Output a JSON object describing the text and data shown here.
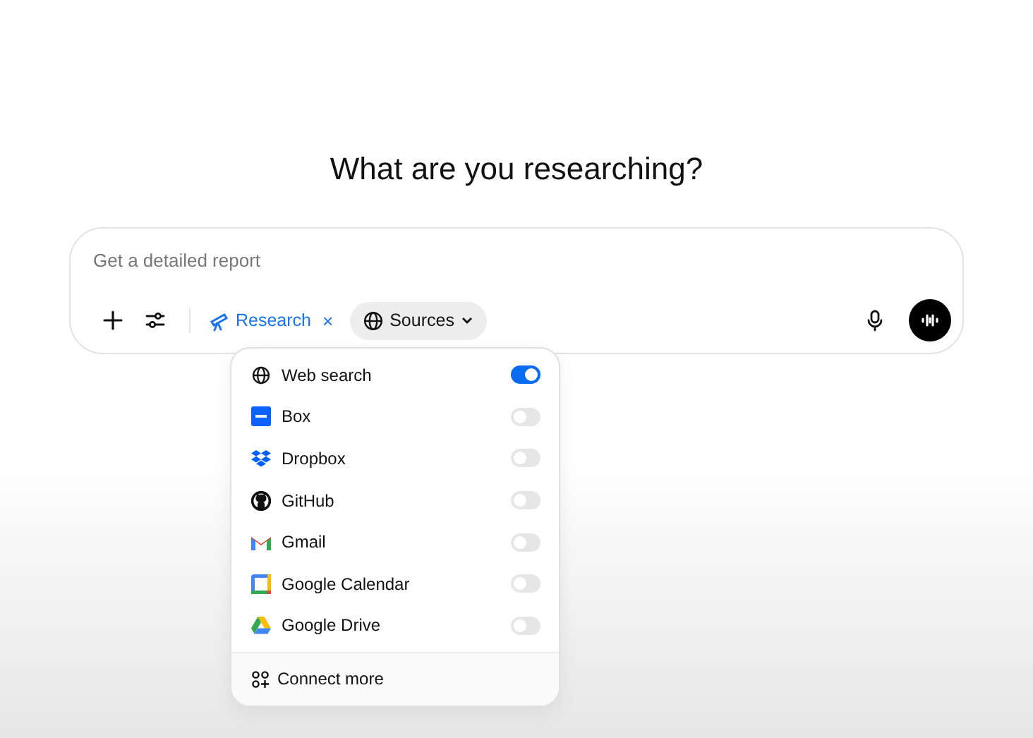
{
  "heading": "What are you researching?",
  "composer": {
    "placeholder": "Get a detailed report",
    "mode_chip": {
      "label": "Research",
      "close": "×"
    },
    "sources_button": {
      "label": "Sources"
    }
  },
  "sources_menu": {
    "items": [
      {
        "kind": "web",
        "label": "Web search",
        "on": true
      },
      {
        "kind": "box",
        "label": "Box",
        "on": false
      },
      {
        "kind": "dropbox",
        "label": "Dropbox",
        "on": false
      },
      {
        "kind": "github",
        "label": "GitHub",
        "on": false
      },
      {
        "kind": "gmail",
        "label": "Gmail",
        "on": false
      },
      {
        "kind": "calendar",
        "label": "Google Calendar",
        "on": false
      },
      {
        "kind": "drive",
        "label": "Google Drive",
        "on": false
      }
    ],
    "footer": "Connect more"
  }
}
